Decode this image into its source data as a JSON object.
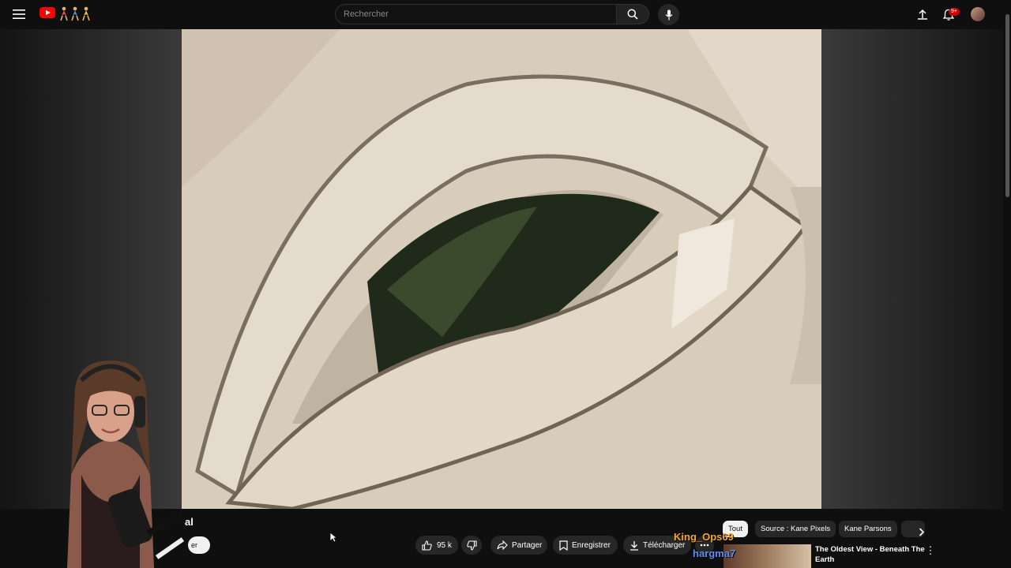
{
  "header": {
    "search_placeholder": "Rechercher",
    "notification_badge": "9+",
    "icons": [
      "menu-icon",
      "youtube-logo",
      "search-icon",
      "microphone-icon",
      "upload-icon",
      "bell-icon"
    ]
  },
  "video": {
    "title_fragment": "al",
    "subscribe_fragment": "er"
  },
  "actions": {
    "like_count": "95 k",
    "share_label": "Partager",
    "save_label": "Enregistrer",
    "download_label": "Télécharger"
  },
  "chips": {
    "all": "Tout",
    "source": "Source : Kane Pixels",
    "channel": "Kane Parsons"
  },
  "recommendation": {
    "title": "The Oldest View - Beneath The Earth"
  },
  "chat_overlay": {
    "user1": "King_Ops69",
    "user2": "hargma7"
  },
  "colors": {
    "background": "#0f0f0f",
    "accent": "#ff0000",
    "chip_active": "#f1f1f1",
    "chat_user1": "#f5a623",
    "chat_user2": "#5b8ff0"
  }
}
